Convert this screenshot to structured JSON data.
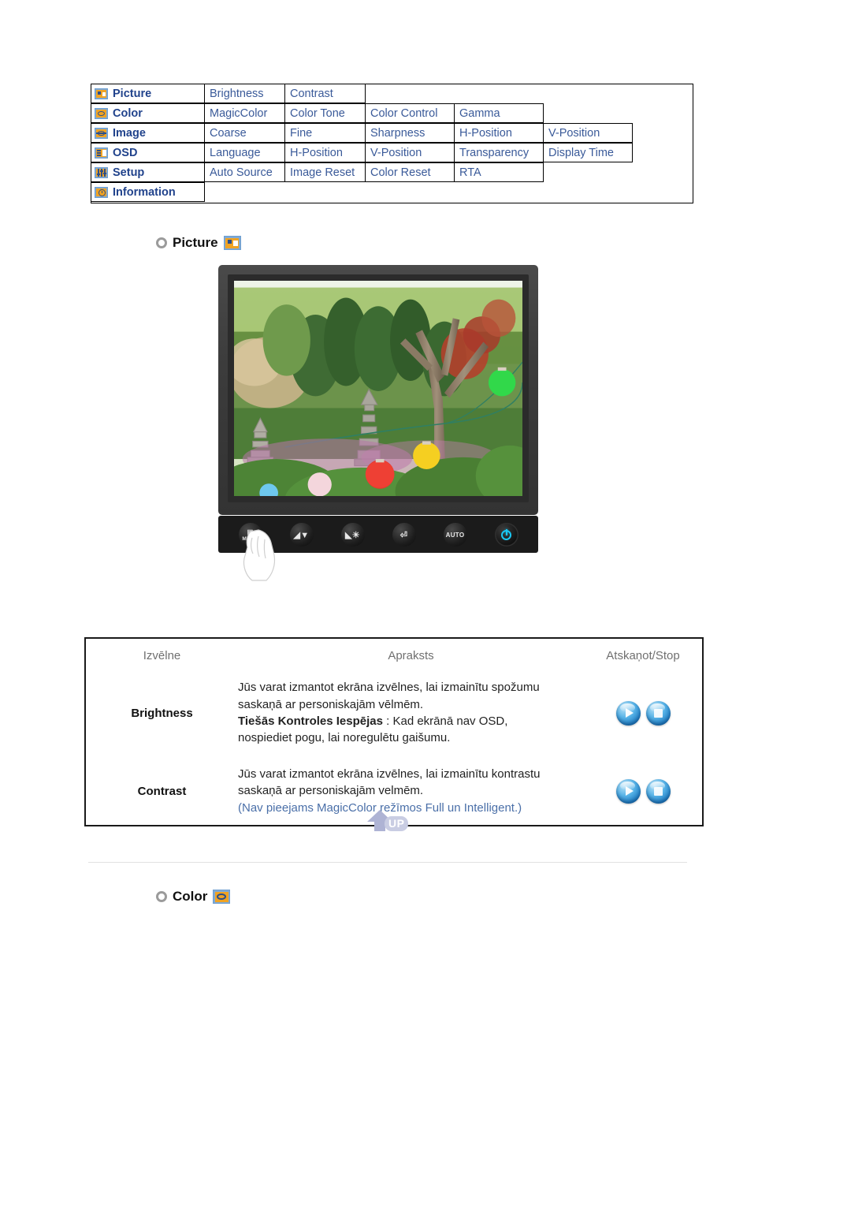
{
  "menu_map": {
    "rows": [
      {
        "icon": "picture-icon",
        "label": "Picture",
        "items": [
          "Brightness",
          "Contrast"
        ]
      },
      {
        "icon": "color-icon",
        "label": "Color",
        "items": [
          "MagicColor",
          "Color Tone",
          "Color Control",
          "Gamma"
        ]
      },
      {
        "icon": "image-icon",
        "label": "Image",
        "items": [
          "Coarse",
          "Fine",
          "Sharpness",
          "H-Position",
          "V-Position"
        ]
      },
      {
        "icon": "osd-icon",
        "label": "OSD",
        "items": [
          "Language",
          "H-Position",
          "V-Position",
          "Transparency",
          "Display Time"
        ]
      },
      {
        "icon": "setup-icon",
        "label": "Setup",
        "items": [
          "Auto Source",
          "Image Reset",
          "Color Reset",
          "RTA"
        ]
      },
      {
        "icon": "information-icon",
        "label": "Information",
        "items": []
      }
    ]
  },
  "sections": {
    "picture": {
      "title": "Picture",
      "icon": "picture-icon",
      "bullet": "bullet-icon"
    },
    "color": {
      "title": "Color",
      "icon": "color-icon",
      "bullet": "bullet-icon"
    }
  },
  "monitor": {
    "buttons": [
      {
        "name": "menu-button",
        "label": "MENU",
        "glyph": "menu-bars-icon"
      },
      {
        "name": "down-button",
        "label": "",
        "glyph": "down-arrow-icon"
      },
      {
        "name": "brightness-button",
        "label": "",
        "glyph": "brightness-up-icon"
      },
      {
        "name": "enter-button",
        "label": "",
        "glyph": "enter-icon"
      },
      {
        "name": "auto-button",
        "label": "AUTO",
        "glyph": "auto-icon"
      },
      {
        "name": "power-button",
        "label": "",
        "glyph": "power-icon"
      }
    ]
  },
  "desc_table": {
    "headers": {
      "menu": "Izvēlne",
      "description": "Apraksts",
      "playstop": "Atskaņot/Stop"
    },
    "rows": [
      {
        "menu": "Brightness",
        "line1": "Jūs varat izmantot ekrāna izvēlnes, lai izmainītu spožumu",
        "line2": "saskaņā ar personiskajām vēlmēm.",
        "bold": "Tiešās Kontroles Iespējas",
        "line3": " : Kad ekrānā nav OSD,",
        "line4": "nospiediet pogu, lai noregulētu gaišumu.",
        "note": ""
      },
      {
        "menu": "Contrast",
        "line1": "Jūs varat izmantot ekrāna izvēlnes, lai izmainītu kontrastu",
        "line2": "saskaņā ar personiskajām velmēm.",
        "bold": "",
        "line3": "",
        "line4": "",
        "note": "(Nav pieejams MagicColor režīmos Full un Intelligent.)"
      }
    ],
    "play_label": "play-icon",
    "stop_label": "stop-icon"
  },
  "up_button": {
    "label": "UP",
    "icon": "up-arrow-icon"
  },
  "colors": {
    "menu_text": "#3a5a99",
    "menu_label": "#21438c",
    "icon_orange": "#f0a323",
    "icon_blue_frame": "#7fa9d6",
    "note_blue": "#4a6fa8",
    "header_gray": "#707070",
    "power_cyan": "#19c8f5"
  }
}
